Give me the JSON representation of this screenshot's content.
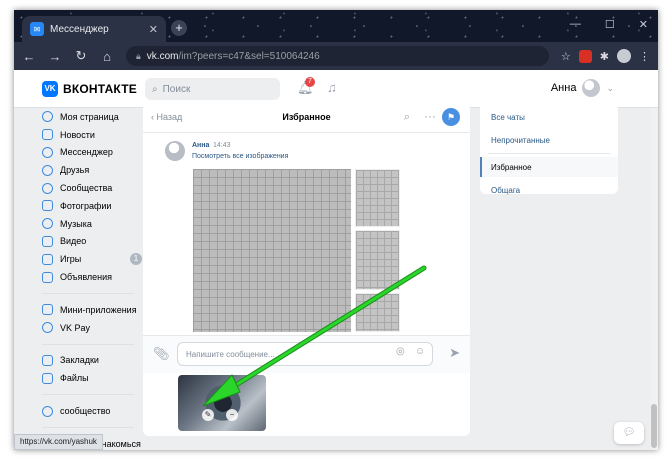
{
  "browser": {
    "tab_title": "Мессенджер",
    "tab_close": "✕",
    "new_tab": "+",
    "url_host": "vk.com",
    "url_path": "/im?peers=c47&sel=510064246",
    "window_controls": [
      "—",
      "☐",
      "✕"
    ]
  },
  "header": {
    "logo_text": "ВКОНТАКТЕ",
    "search_placeholder": "Поиск",
    "notification_count": "7",
    "user_name": "Анна"
  },
  "sidebar": {
    "items": [
      {
        "label": "Моя страница",
        "icon": "user-icon"
      },
      {
        "label": "Новости",
        "icon": "news-icon"
      },
      {
        "label": "Мессенджер",
        "icon": "messenger-icon"
      },
      {
        "label": "Друзья",
        "icon": "friends-icon"
      },
      {
        "label": "Сообщества",
        "icon": "communities-icon"
      },
      {
        "label": "Фотографии",
        "icon": "photos-icon"
      },
      {
        "label": "Музыка",
        "icon": "music-icon"
      },
      {
        "label": "Видео",
        "icon": "video-icon"
      },
      {
        "label": "Игры",
        "icon": "games-icon",
        "badge": "1"
      },
      {
        "label": "Объявления",
        "icon": "ads-icon"
      }
    ],
    "group2": [
      {
        "label": "Мини-приложения",
        "icon": "apps-icon"
      },
      {
        "label": "VK Pay",
        "icon": "vkpay-icon"
      }
    ],
    "group3": [
      {
        "label": "Закладки",
        "icon": "bookmarks-icon"
      },
      {
        "label": "Файлы",
        "icon": "files-icon"
      }
    ],
    "group4": [
      {
        "label": "сообщество",
        "icon": "community-icon"
      }
    ],
    "group5": [
      {
        "label": "Целуй и Знакомься",
        "icon": "app-icon"
      }
    ]
  },
  "chat": {
    "back_label": "Назад",
    "title": "Избранное",
    "message": {
      "author": "Анна",
      "time": "14:43",
      "link_text": "Посмотреть все изображения"
    },
    "compose_placeholder": "Напишите сообщение..."
  },
  "right_panel": {
    "items": [
      {
        "label": "Все чаты",
        "active": false
      },
      {
        "label": "Непрочитанные",
        "active": false
      },
      {
        "label": "Избранное",
        "active": true
      },
      {
        "label": "Общага",
        "active": false
      }
    ]
  },
  "status_bar": {
    "url": "https://vk.com/yashuk"
  },
  "colors": {
    "accent": "#0077ff",
    "arrow": "#22c422",
    "link": "#2a5885"
  }
}
